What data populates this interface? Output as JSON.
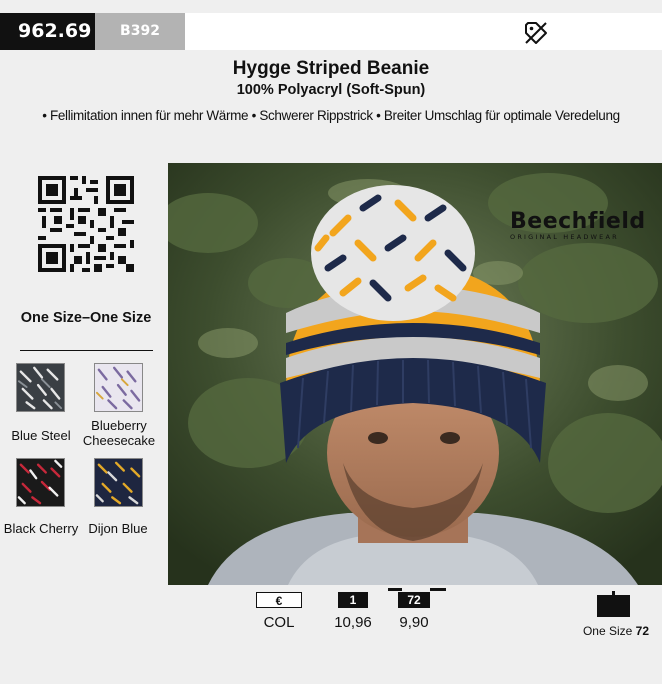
{
  "header": {
    "article_number": "962.69",
    "supplier_code": "B392"
  },
  "product": {
    "name": "Hygge Striped Beanie",
    "material": "100% Polyacryl (Soft-Spun)",
    "features": "• Fellimitation innen für mehr Wärme • Schwerer Rippstrick • Breiter Umschlag für optimale Veredelung"
  },
  "sizes": {
    "title": "One Size–One Size"
  },
  "colors": [
    {
      "name": "Blue Steel",
      "swatch_hex": "#5a5f63"
    },
    {
      "name": "Blueberry Cheesecake",
      "swatch_hex": "#8a7aa6"
    },
    {
      "name": "Black Cherry",
      "swatch_hex": "#7a1e2a"
    },
    {
      "name": "Dijon Blue",
      "swatch_hex": "#2c3550"
    }
  ],
  "brand": {
    "name": "Beechfield",
    "tagline": "ORIGINAL HEADWEAR"
  },
  "pricing": {
    "currency_label": "€",
    "currency_value": "COL",
    "qty1_label": "1",
    "qty1_price": "10,96",
    "qty72_label": "72",
    "qty72_price": "9,90"
  },
  "packaging": {
    "label": "One Size",
    "qty": "72"
  },
  "colors_theme": {
    "header_black": "#111111",
    "header_gray": "#b3b3b3",
    "background": "#efefef"
  }
}
